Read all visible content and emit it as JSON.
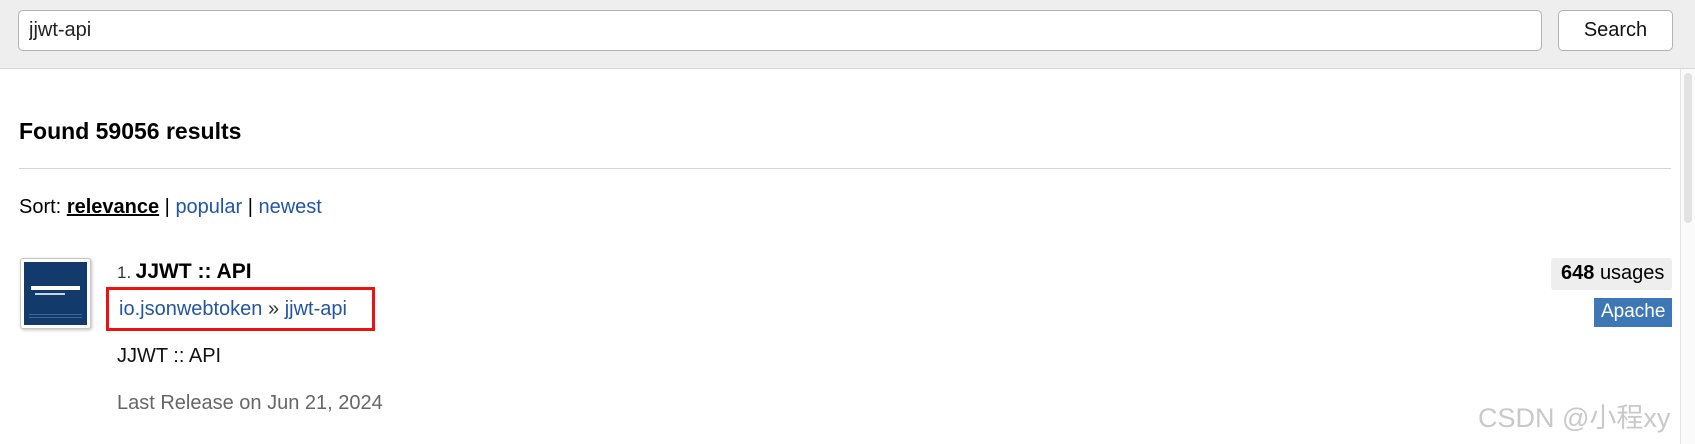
{
  "search": {
    "value": "jjwt-api",
    "button_label": "Search"
  },
  "results": {
    "heading": "Found 59056 results",
    "sort": {
      "label": "Sort:",
      "active": "relevance",
      "separator": "|",
      "options": [
        "popular",
        "newest"
      ]
    }
  },
  "items": [
    {
      "rank": "1.",
      "title": "JJWT :: API",
      "group": "io.jsonwebtoken",
      "coord_separator": "»",
      "artifact": "jjwt-api",
      "description": "JJWT :: API",
      "last_release": "Last Release on Jun 21, 2024",
      "usages_count": "648",
      "usages_label": "usages",
      "license": "Apache",
      "logo_icon": "json-web-token-logo-icon",
      "logo_color": "#123a6b"
    }
  ],
  "colors": {
    "link": "#2255a4",
    "highlight_box": "#ee1111",
    "license_badge": "#3e77b6"
  },
  "watermark": "CSDN @小程xy"
}
